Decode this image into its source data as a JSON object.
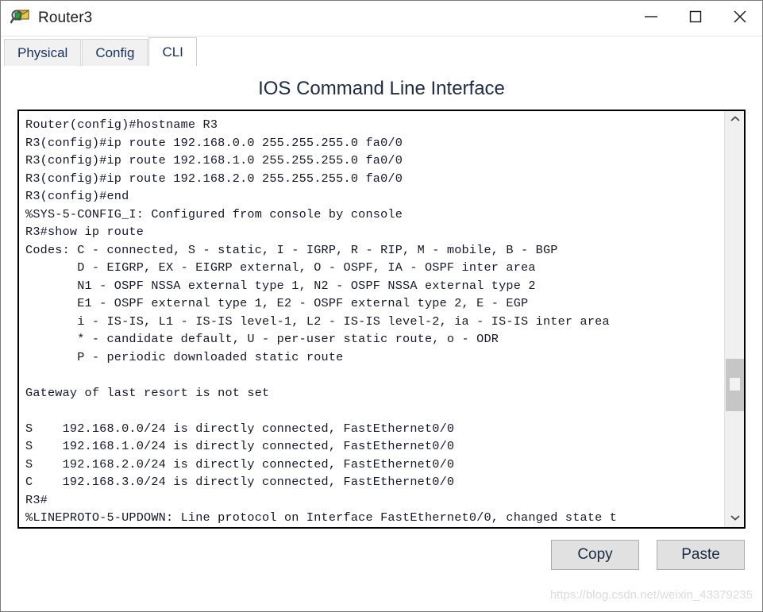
{
  "window": {
    "title": "Router3",
    "icon": "router-magnifier-icon",
    "controls": {
      "minimize": "minimize-icon",
      "maximize": "maximize-icon",
      "close": "close-icon"
    }
  },
  "tabs": [
    {
      "label": "Physical",
      "active": false
    },
    {
      "label": "Config",
      "active": false
    },
    {
      "label": "CLI",
      "active": true
    }
  ],
  "panel": {
    "title": "IOS Command Line Interface"
  },
  "terminal": {
    "lines": [
      "Router(config)#hostname R3",
      "R3(config)#ip route 192.168.0.0 255.255.255.0 fa0/0",
      "R3(config)#ip route 192.168.1.0 255.255.255.0 fa0/0",
      "R3(config)#ip route 192.168.2.0 255.255.255.0 fa0/0",
      "R3(config)#end",
      "%SYS-5-CONFIG_I: Configured from console by console",
      "R3#show ip route",
      "Codes: C - connected, S - static, I - IGRP, R - RIP, M - mobile, B - BGP",
      "       D - EIGRP, EX - EIGRP external, O - OSPF, IA - OSPF inter area",
      "       N1 - OSPF NSSA external type 1, N2 - OSPF NSSA external type 2",
      "       E1 - OSPF external type 1, E2 - OSPF external type 2, E - EGP",
      "       i - IS-IS, L1 - IS-IS level-1, L2 - IS-IS level-2, ia - IS-IS inter area",
      "       * - candidate default, U - per-user static route, o - ODR",
      "       P - periodic downloaded static route",
      "",
      "Gateway of last resort is not set",
      "",
      "S    192.168.0.0/24 is directly connected, FastEthernet0/0",
      "S    192.168.1.0/24 is directly connected, FastEthernet0/0",
      "S    192.168.2.0/24 is directly connected, FastEthernet0/0",
      "C    192.168.3.0/24 is directly connected, FastEthernet0/0",
      "R3#",
      "%LINEPROTO-5-UPDOWN: Line protocol on Interface FastEthernet0/0, changed state t"
    ]
  },
  "scrollbar": {
    "up_arrow": "chevron-up-icon",
    "down_arrow": "chevron-down-icon"
  },
  "footer": {
    "copy_label": "Copy",
    "paste_label": "Paste"
  },
  "watermark": "https://blog.csdn.net/weixin_43379235",
  "colors": {
    "terminal_text": "#15172b",
    "panel_title": "#1f2b44",
    "tab_text": "#16325c",
    "button_face": "#e1e1e1",
    "scroll_thumb": "#c6c6c6"
  }
}
